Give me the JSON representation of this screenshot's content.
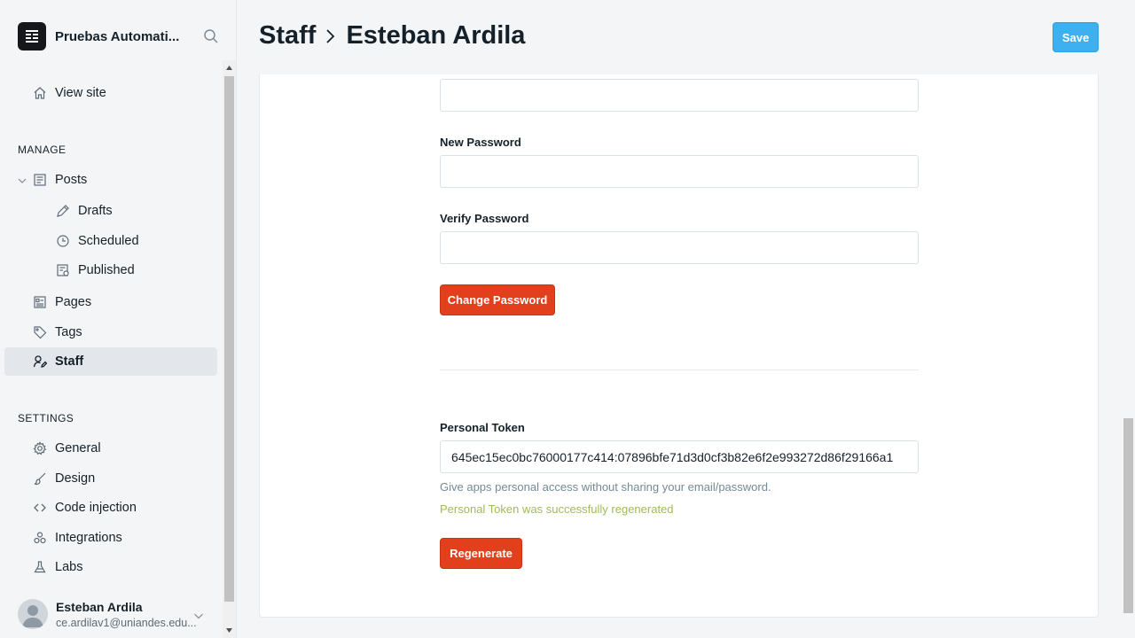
{
  "sidebar": {
    "site_title": "Pruebas Automati...",
    "view_site": "View site",
    "manage_heading": "MANAGE",
    "posts": "Posts",
    "drafts": "Drafts",
    "scheduled": "Scheduled",
    "published": "Published",
    "pages": "Pages",
    "tags": "Tags",
    "staff": "Staff",
    "settings_heading": "SETTINGS",
    "general": "General",
    "design": "Design",
    "code_injection": "Code injection",
    "integrations": "Integrations",
    "labs": "Labs",
    "user_name": "Esteban Ardila",
    "user_email": "ce.ardilav1@uniandes.edu..."
  },
  "header": {
    "crumb_parent": "Staff",
    "crumb_current": "Esteban Ardila",
    "save_label": "Save"
  },
  "form": {
    "old_password_value": "",
    "new_password_label": "New Password",
    "new_password_value": "",
    "verify_password_label": "Verify Password",
    "verify_password_value": "",
    "change_password_label": "Change Password",
    "token_label": "Personal Token",
    "token_value": "645ec15ec0bc76000177c414:07896bfe71d3d0cf3b82e6f2e993272d86f29166a1",
    "token_hint": "Give apps personal access without sharing your email/password.",
    "token_success": "Personal Token was successfully regenerated",
    "regenerate_label": "Regenerate"
  },
  "colors": {
    "accent_blue": "#3eb0ef",
    "danger_red": "#e2401c",
    "success_green": "#9fbb58"
  }
}
